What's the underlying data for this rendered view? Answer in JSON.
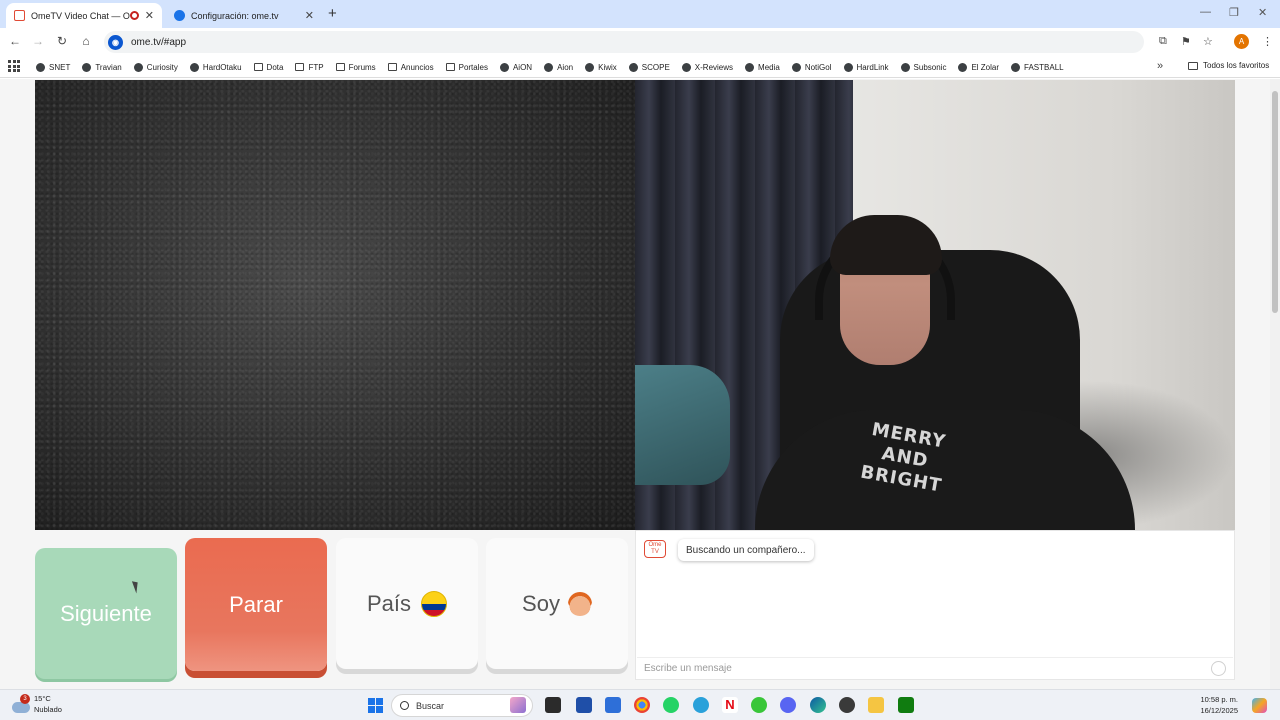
{
  "browser": {
    "tabs": [
      {
        "title": "OmeTV Video Chat — Ome",
        "active": true
      },
      {
        "title": "Configuración: ome.tv",
        "active": false
      }
    ],
    "url": "ome.tv/#app",
    "bookmarks": [
      {
        "label": "SNET",
        "icon": "globe"
      },
      {
        "label": "Travian",
        "icon": "globe"
      },
      {
        "label": "Curiosity",
        "icon": "globe"
      },
      {
        "label": "HardOtaku",
        "icon": "globe"
      },
      {
        "label": "Dota",
        "icon": "folder"
      },
      {
        "label": "FTP",
        "icon": "folder"
      },
      {
        "label": "Forums",
        "icon": "folder"
      },
      {
        "label": "Anuncios",
        "icon": "folder"
      },
      {
        "label": "Portales",
        "icon": "folder"
      },
      {
        "label": "AiON",
        "icon": "globe"
      },
      {
        "label": "Aion",
        "icon": "globe"
      },
      {
        "label": "Kiwix",
        "icon": "globe"
      },
      {
        "label": "SCOPE",
        "icon": "globe"
      },
      {
        "label": "X-Reviews",
        "icon": "globe"
      },
      {
        "label": "Media",
        "icon": "globe"
      },
      {
        "label": "NotiGol",
        "icon": "globe"
      },
      {
        "label": "HardLink",
        "icon": "globe"
      },
      {
        "label": "Subsonic",
        "icon": "globe"
      },
      {
        "label": "El Zolar",
        "icon": "globe"
      },
      {
        "label": "FASTBALL",
        "icon": "globe"
      }
    ],
    "all_bookmarks": "Todos los favoritos",
    "profile_initial": "A"
  },
  "app": {
    "buttons": {
      "next": "Siguiente",
      "stop": "Parar",
      "country": "País",
      "gender": "Soy"
    },
    "chat": {
      "logo": "Ome TV",
      "status_message": "Buscando un compañero...",
      "input_placeholder": "Escribe un mensaje"
    },
    "video": {
      "shirt_text": "MERRY AND BRIGHT"
    },
    "colors": {
      "next": "#a8d9b9",
      "stop": "#ea6b50",
      "accent": "#e04a35"
    }
  },
  "taskbar": {
    "weather_temp": "15°C",
    "weather_desc": "Nublado",
    "weather_badge": "3",
    "search_placeholder": "Buscar",
    "time": "10:58 p. m.",
    "date": "16/12/2025"
  }
}
